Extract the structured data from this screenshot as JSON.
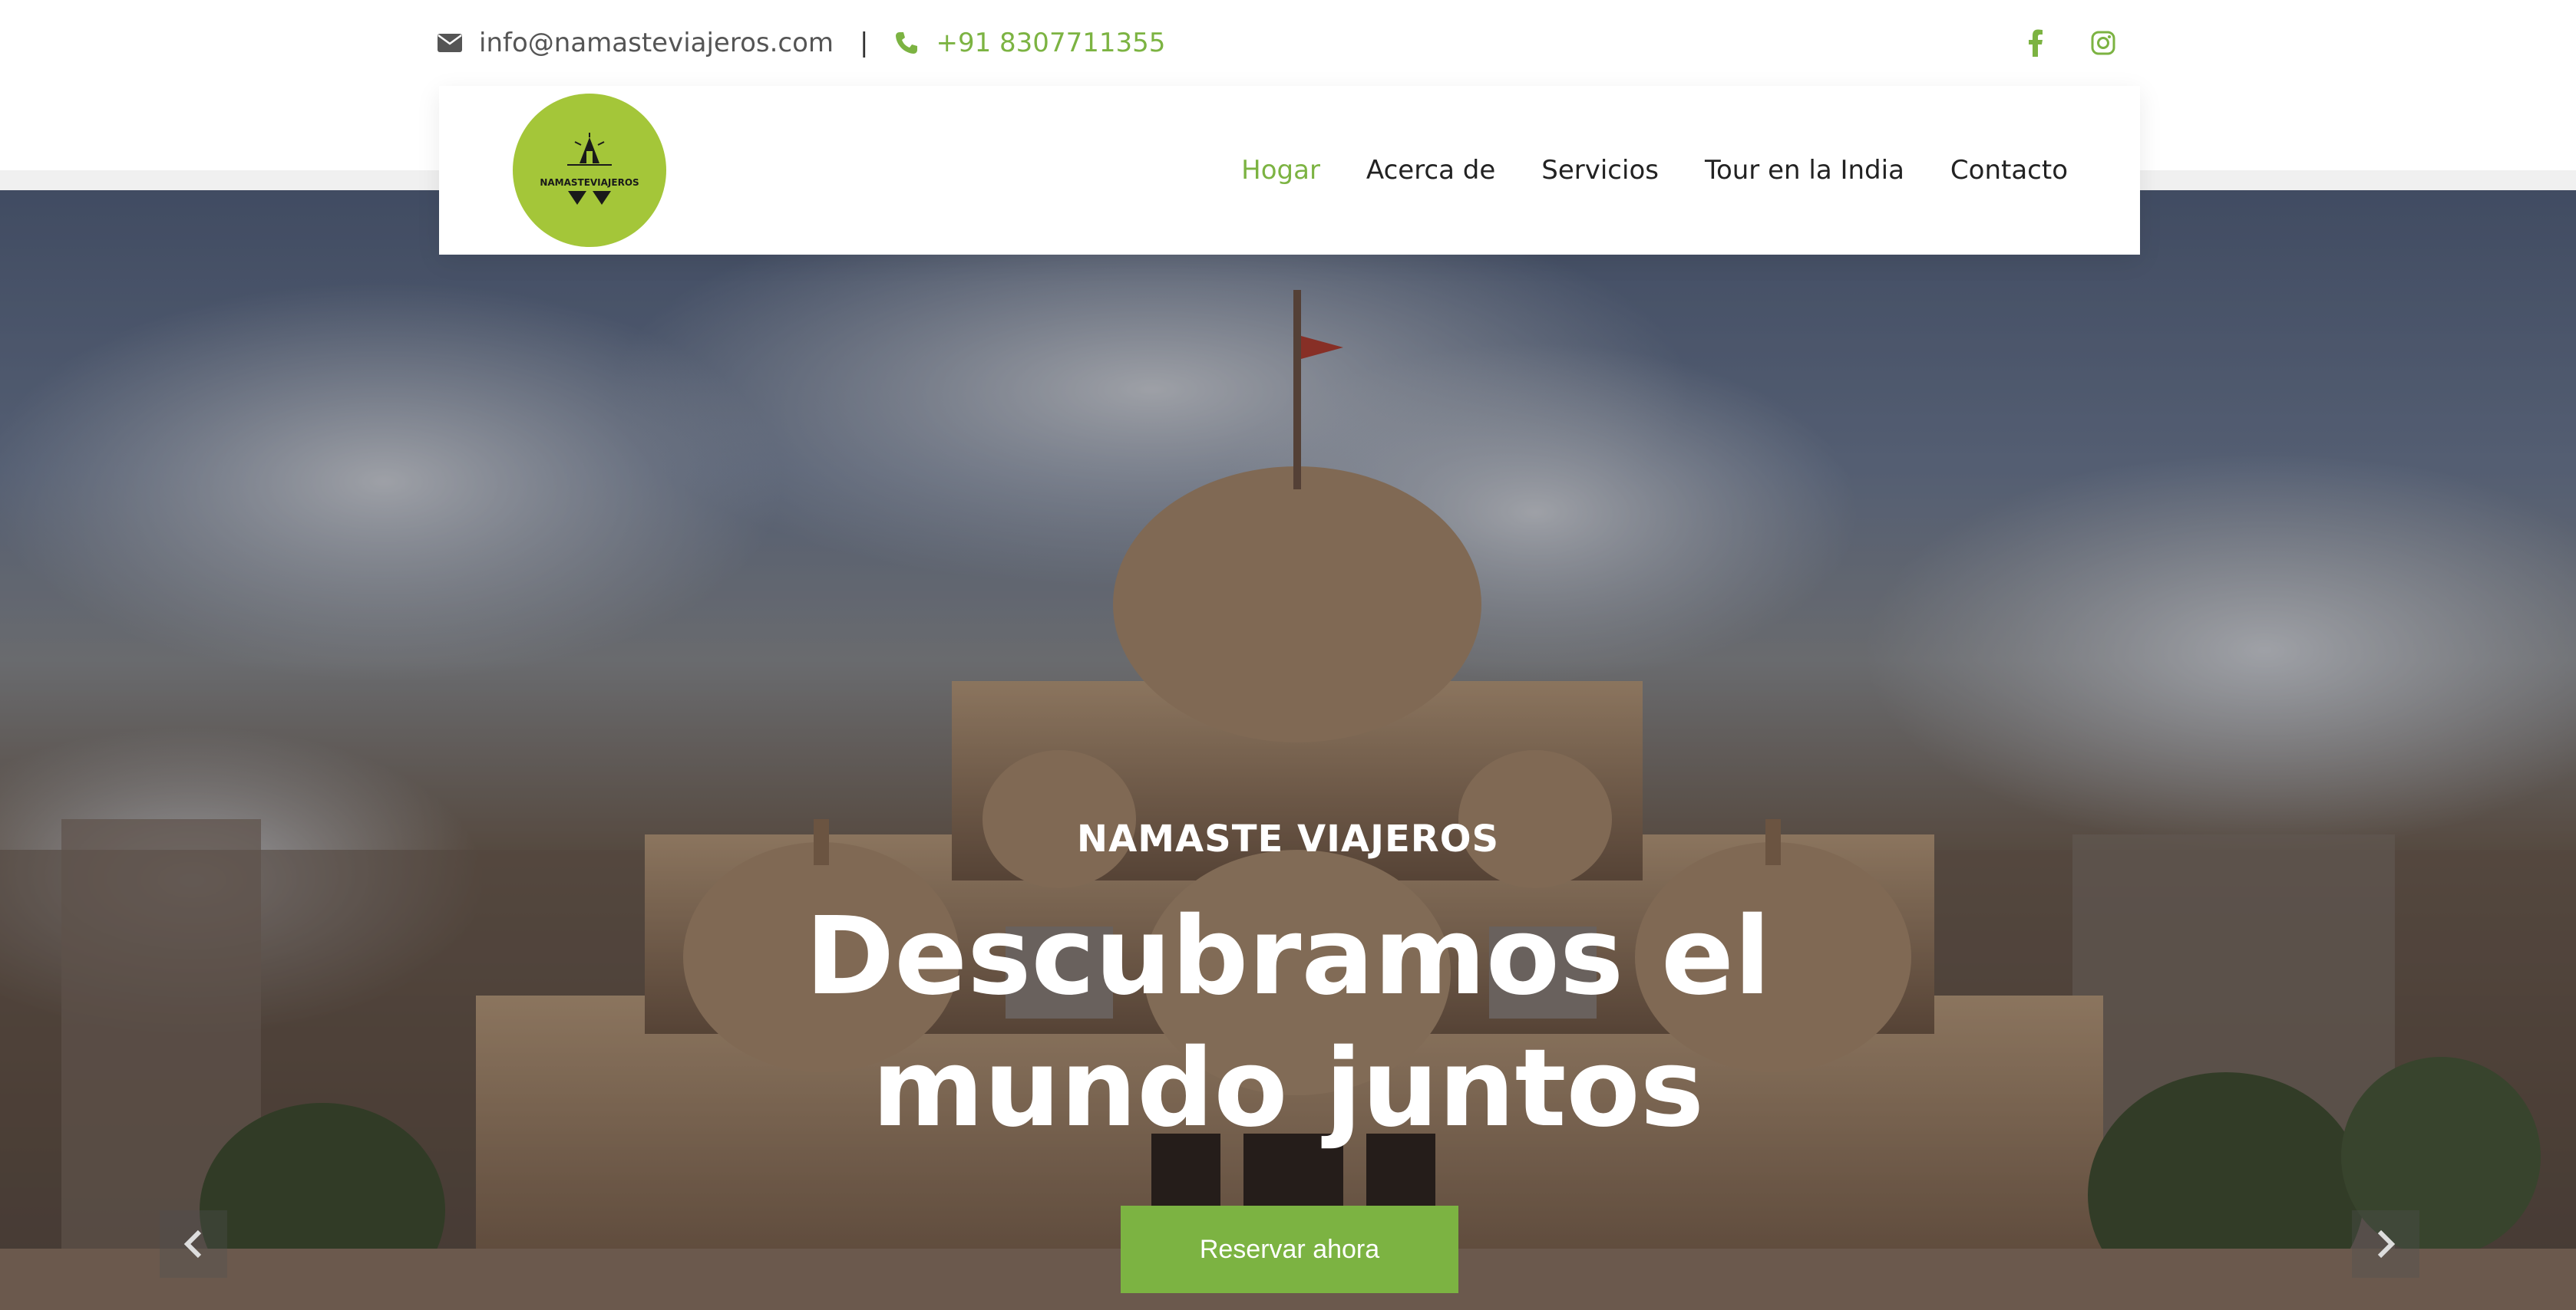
{
  "topbar": {
    "email": "info@namasteviajeros.com",
    "separator": "|",
    "phone": "+91 8307711355",
    "social": [
      "facebook-icon",
      "instagram-icon"
    ]
  },
  "logo": {
    "text": "NAMASTEVIAJEROS"
  },
  "nav": {
    "items": [
      {
        "label": "Hogar",
        "active": true
      },
      {
        "label": "Acerca de",
        "active": false
      },
      {
        "label": "Servicios",
        "active": false
      },
      {
        "label": "Tour en la India",
        "active": false
      },
      {
        "label": "Contacto",
        "active": false
      }
    ]
  },
  "hero": {
    "subtitle": "NAMASTE VIAJEROS",
    "title_line1": "Descubramos el",
    "title_line2": "mundo juntos",
    "cta_label": "Reservar ahora"
  },
  "colors": {
    "accent": "#7cb342",
    "logo_bg": "#a4c639",
    "text_dark": "#222222"
  }
}
